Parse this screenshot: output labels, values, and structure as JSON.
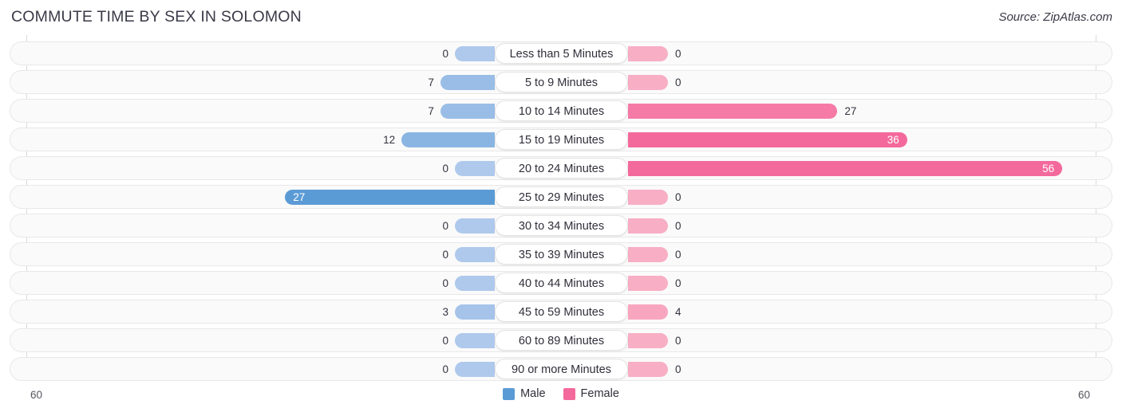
{
  "header": {
    "title": "COMMUTE TIME BY SEX IN SOLOMON",
    "source": "Source: ZipAtlas.com"
  },
  "legend": {
    "items": [
      {
        "label": "Male",
        "color": "#5B9BD5"
      },
      {
        "label": "Female",
        "color": "#F4699B"
      }
    ]
  },
  "axis": {
    "left_label": "60",
    "right_label": "60",
    "max": 60
  },
  "chart_data": {
    "type": "bar",
    "subtype": "diverging-butterfly",
    "title": "COMMUTE TIME BY SEX IN SOLOMON",
    "xlabel": "",
    "ylabel": "",
    "xlim": [
      60,
      60
    ],
    "grid": false,
    "legend_position": "bottom-center",
    "categories": [
      "Less than 5 Minutes",
      "5 to 9 Minutes",
      "10 to 14 Minutes",
      "15 to 19 Minutes",
      "20 to 24 Minutes",
      "25 to 29 Minutes",
      "30 to 34 Minutes",
      "35 to 39 Minutes",
      "40 to 44 Minutes",
      "45 to 59 Minutes",
      "60 to 89 Minutes",
      "90 or more Minutes"
    ],
    "series": [
      {
        "name": "Male",
        "direction": "left",
        "color": "#5B9BD5",
        "values": [
          0,
          7,
          7,
          12,
          0,
          27,
          0,
          0,
          0,
          3,
          0,
          0
        ],
        "labels": [
          "0",
          "7",
          "7",
          "12",
          "0",
          "27",
          "0",
          "0",
          "0",
          "3",
          "0",
          "0"
        ]
      },
      {
        "name": "Female",
        "direction": "right",
        "color": "#F4699B",
        "values": [
          0,
          0,
          27,
          36,
          56,
          0,
          0,
          0,
          0,
          4,
          0,
          0
        ],
        "labels": [
          "0",
          "0",
          "27",
          "36",
          "56",
          "0",
          "0",
          "0",
          "0",
          "4",
          "0",
          "0"
        ]
      }
    ]
  }
}
